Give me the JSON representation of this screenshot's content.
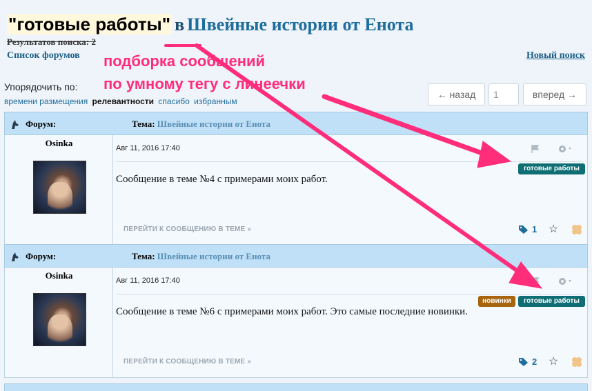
{
  "header": {
    "tag": "\"готовые работы\"",
    "in_word": "в",
    "forum_title": "Швейные истории от Енота",
    "results": "Результатов поиска: 2",
    "forum_list_link": "Список форумов",
    "new_search_link": "Новый поиск"
  },
  "sort": {
    "label": "Упорядочить по:",
    "options": [
      "времени размещения",
      "релевантности",
      "спасибо",
      "избранным"
    ],
    "active_index": 1
  },
  "pager": {
    "prev": "← назад",
    "page": "1",
    "next": "вперед →"
  },
  "annotation": {
    "line1": "подборка сообщений",
    "line2": "по умному тегу с линеечки",
    "color": "#ff2d7a"
  },
  "posts": [
    {
      "forum_label": "Форум:",
      "theme_label": "Тема:",
      "theme_name": "Швейные истории от Енота",
      "author": "Osinka",
      "date": "Авг 11, 2016 17:40",
      "tags": [
        "готовые работы"
      ],
      "message": "Сообщение в теме №4 с примерами моих работ.",
      "goto": "ПЕРЕЙТИ К СООБЩЕНИЮ В ТЕМЕ »",
      "tag_count": "1"
    },
    {
      "forum_label": "Форум:",
      "theme_label": "Тема:",
      "theme_name": "Швейные истории от Енота",
      "author": "Osinka",
      "date": "Авг 11, 2016 17:40",
      "tags": [
        "новинки",
        "готовые работы"
      ],
      "message": "Сообщение в теме №6 с примерами моих работ. Это самые последние новинки.",
      "goto": "ПЕРЕЙТИ К СООБЩЕНИЮ В ТЕМЕ »",
      "tag_count": "2"
    }
  ],
  "colors": {
    "tag_ready": "#0e6e74",
    "tag_new": "#a8650e",
    "topic_bar": "#bfe0f7",
    "link": "#1f6d9c"
  }
}
